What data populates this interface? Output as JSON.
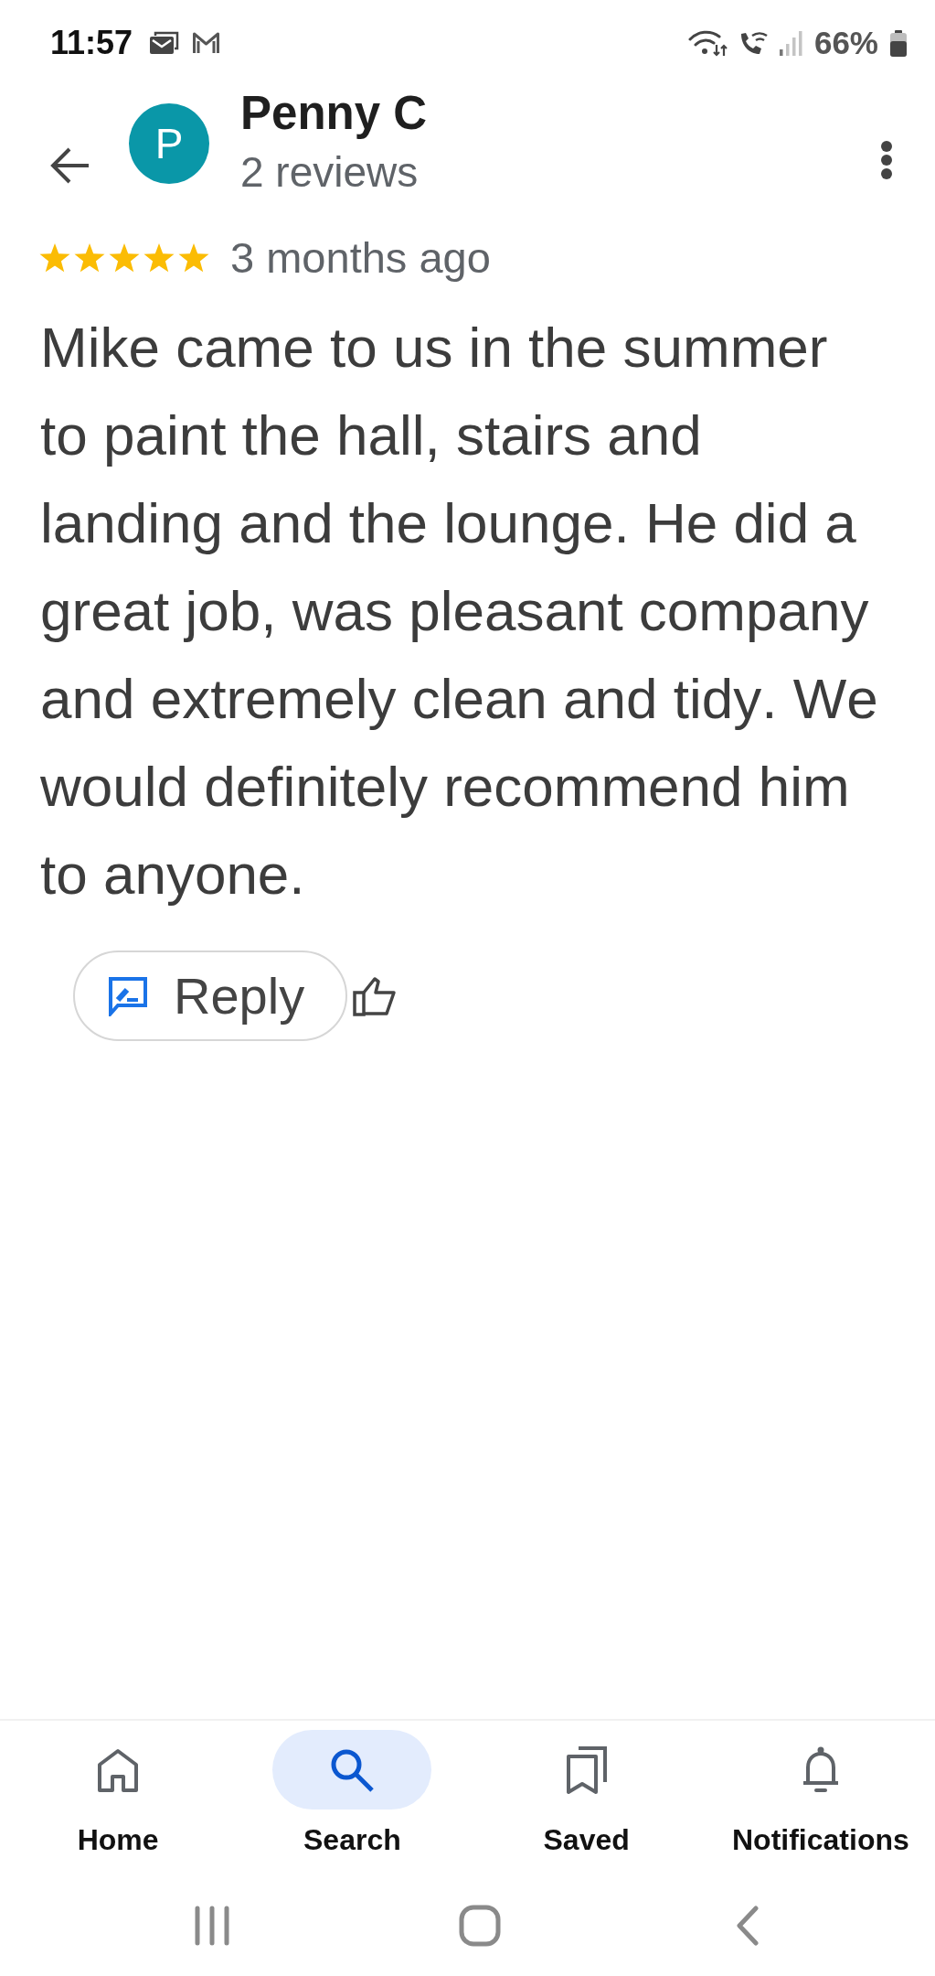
{
  "status_bar": {
    "time": "11:57",
    "battery_text": "66%"
  },
  "header": {
    "avatar_letter": "P",
    "name": "Penny C",
    "review_count": "2 reviews"
  },
  "review": {
    "stars": 5,
    "date": "3 months ago",
    "text": "Mike came to us in the summer to paint the hall, stairs and landing and the lounge. He did a great job, was pleasant company and extremely clean and tidy. We would definitely recommend him to anyone."
  },
  "actions": {
    "reply": "Reply"
  },
  "bottom_nav": [
    {
      "kind": "home",
      "label": "Home",
      "selected": false
    },
    {
      "kind": "search",
      "label": "Search",
      "selected": true
    },
    {
      "kind": "saved",
      "label": "Saved",
      "selected": false
    },
    {
      "kind": "notifications",
      "label": "Notifications",
      "selected": false
    }
  ]
}
